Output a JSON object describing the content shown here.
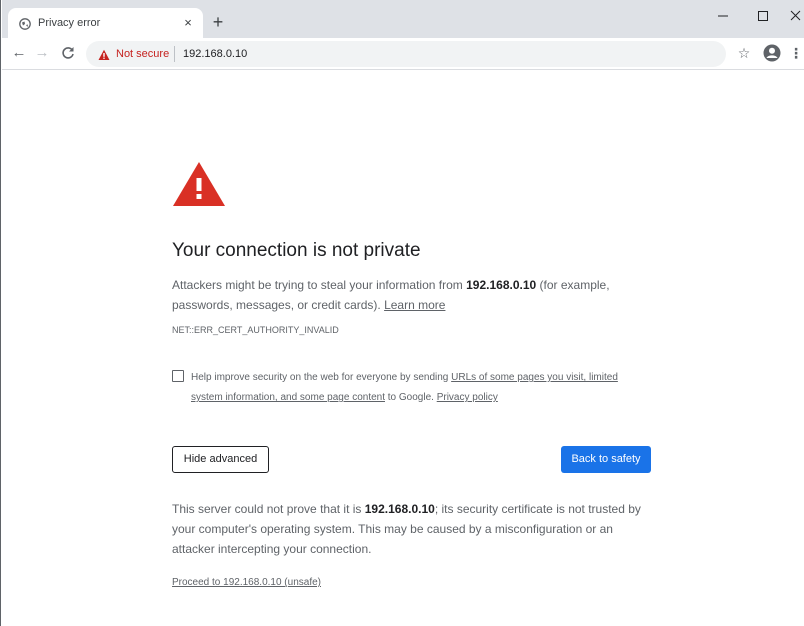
{
  "browser": {
    "tab": {
      "title": "Privacy error",
      "favicon": "globe-icon",
      "close_glyph": "×"
    },
    "new_tab_glyph": "+",
    "window_controls": {
      "minimize": "–",
      "maximize": "☐",
      "close": "✕"
    },
    "toolbar": {
      "back_glyph": "←",
      "forward_glyph": "→",
      "reload_glyph": "C",
      "security_label": "Not secure",
      "url": "192.168.0.10",
      "bookmark_glyph": "☆",
      "menu_glyph": "⋮"
    }
  },
  "page": {
    "heading": "Your connection is not private",
    "explanation_prefix": "Attackers might be trying to steal your information from ",
    "host": "192.168.0.10",
    "explanation_suffix": " (for example, passwords, messages, or credit cards). ",
    "learn_more": "Learn more",
    "error_code": "NET::ERR_CERT_AUTHORITY_INVALID",
    "optin": {
      "checked": false,
      "prefix": "Help improve security on the web for everyone by sending ",
      "link_data": "URLs of some pages you visit, limited system information, and some page content",
      "middle": " to Google. ",
      "privacy_link": "Privacy policy"
    },
    "hide_advanced_label": "Hide advanced",
    "back_to_safety_label": "Back to safety",
    "details_prefix": "This server could not prove that it is ",
    "details_host": "192.168.0.10",
    "details_suffix": "; its security certificate is not trusted by your computer's operating system. This may be caused by a misconfiguration or an attacker intercepting your connection.",
    "proceed_link": "Proceed to 192.168.0.10 (unsafe)"
  },
  "colors": {
    "warning_red": "#d93025",
    "primary_button": "#1a73e8",
    "not_secure_text": "#c5221f"
  }
}
